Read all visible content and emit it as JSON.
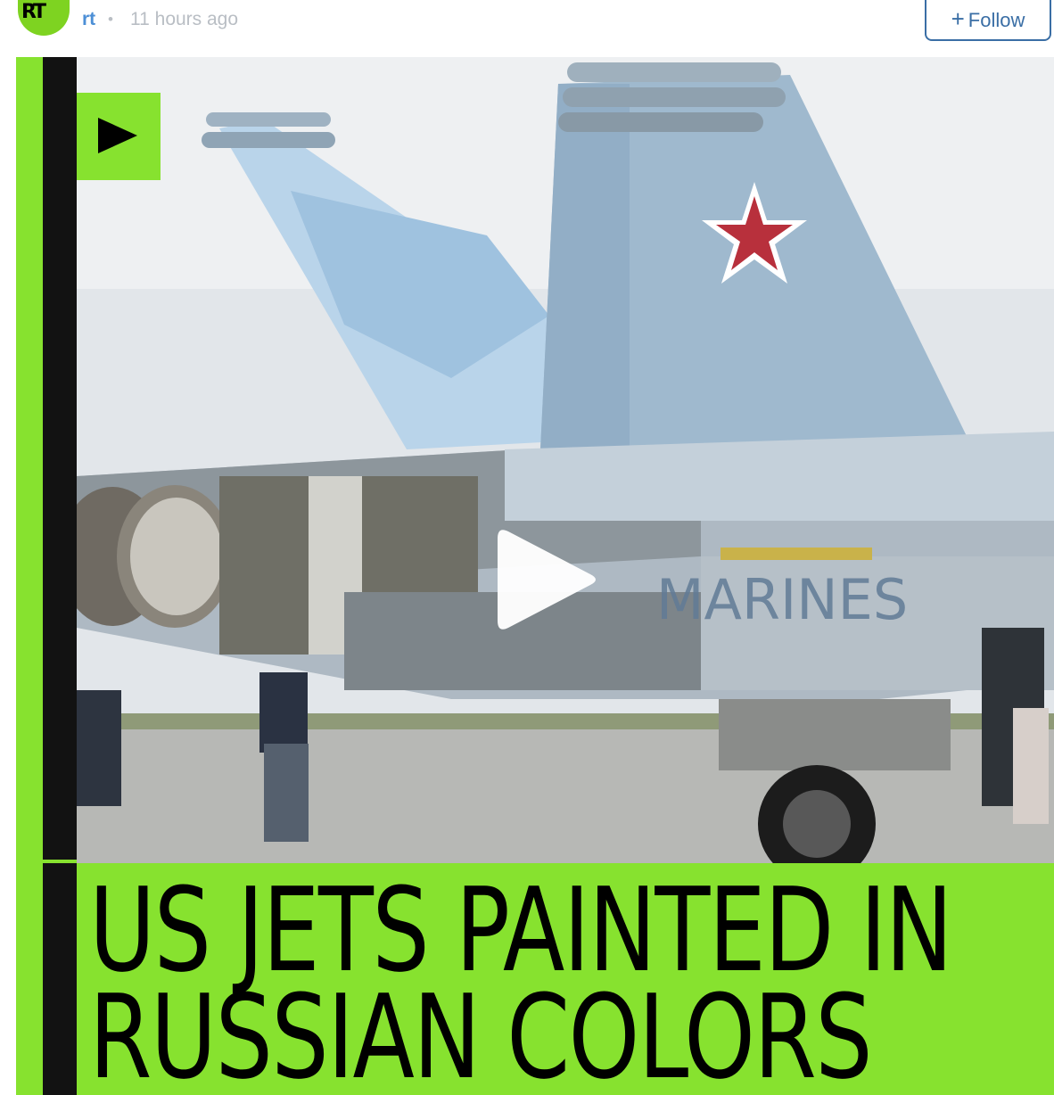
{
  "post": {
    "avatar_text": "RT",
    "author": "rt",
    "separator": "•",
    "time": "11 hours ago",
    "follow_plus": "+",
    "follow_label": "Follow"
  },
  "video": {
    "fuselage_text": "MARINES",
    "caption_line1": "US JETS PAINTED IN",
    "caption_line2": "RUSSIAN COLORS"
  },
  "colors": {
    "brand_green": "#87e22f",
    "link_blue": "#4c8fd6",
    "follow_blue": "#3a6ea5",
    "muted_gray": "#b9bec4"
  },
  "icons": [
    "play-icon",
    "play-button-icon",
    "red-star-icon"
  ]
}
